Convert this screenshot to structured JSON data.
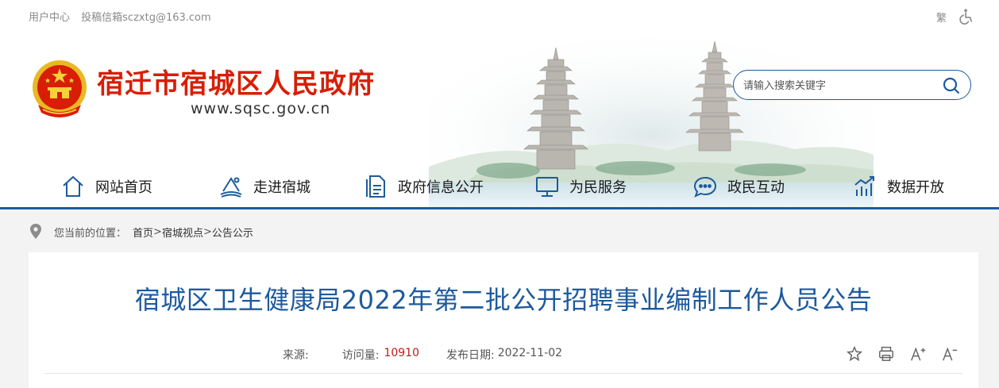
{
  "topbar": {
    "user_center": "用户中心",
    "submission_email": "投稿信箱sczxtg@163.com",
    "traditional": "繁",
    "accessibility_icon": "wheelchair-icon"
  },
  "header": {
    "site_name": "宿迁市宿城区人民政府",
    "domain": "www.sqsc.gov.cn",
    "brand_color": "#d81e06"
  },
  "search": {
    "placeholder": "请输入搜索关键字",
    "icon": "search-icon"
  },
  "nav": {
    "items": [
      {
        "label": "网站首页",
        "icon": "home-icon"
      },
      {
        "label": "走进宿城",
        "icon": "landmark-icon"
      },
      {
        "label": "政府信息公开",
        "icon": "document-icon"
      },
      {
        "label": "为民服务",
        "icon": "monitor-icon"
      },
      {
        "label": "政民互动",
        "icon": "chat-icon"
      },
      {
        "label": "数据开放",
        "icon": "chart-icon"
      }
    ],
    "accent_color": "#1d5a9e"
  },
  "breadcrumb": {
    "prefix": "您当前的位置：",
    "items": [
      "首页",
      "宿城视点",
      "公告公示"
    ],
    "separator": ">"
  },
  "article": {
    "title": "宿城区卫生健康局2022年第二批公开招聘事业编制工作人员公告",
    "source_label": "来源:",
    "source_value": "",
    "visits_label": "访问量:",
    "visits_value": "10910",
    "date_label": "发布日期:",
    "date_value": "2022-11-02"
  },
  "tools": [
    "star-icon",
    "print-icon",
    "font-increase-icon",
    "font-decrease-icon"
  ]
}
